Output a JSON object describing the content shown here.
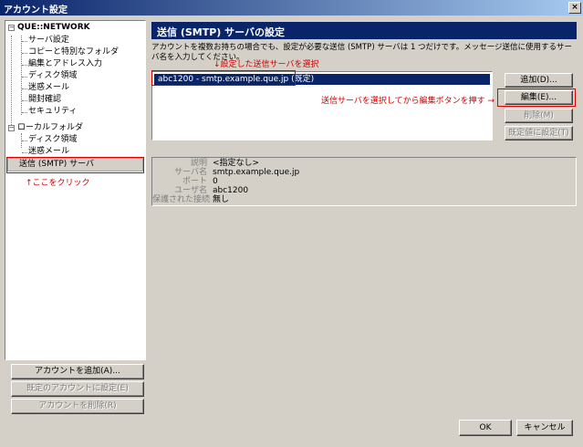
{
  "window": {
    "title": "アカウント設定",
    "close": "×"
  },
  "tree": {
    "account": "QUE::NETWORK",
    "account_children": [
      "サーバ設定",
      "コピーと特別なフォルダ",
      "編集とアドレス入力",
      "ディスク領域",
      "迷惑メール",
      "開封確認",
      "セキュリティ"
    ],
    "local": "ローカルフォルダ",
    "local_children": [
      "ディスク領域",
      "迷惑メール"
    ],
    "smtp": "送信 (SMTP) サーバ",
    "expand_glyph": "−"
  },
  "annotations": {
    "click_here": "↑ここをクリック",
    "select_server": "↓設定した送信サーバを選択",
    "press_edit": "送信サーバを選択してから編集ボタンを押す →"
  },
  "left_buttons": {
    "add_account": "アカウントを追加(A)...",
    "set_default": "既定のアカウントに設定(E)",
    "remove_account": "アカウントを削除(R)"
  },
  "panel": {
    "title": "送信 (SMTP) サーバの設定",
    "description": "アカウントを複数お持ちの場合でも、設定が必要な送信 (SMTP) サーバは 1 つだけです。メッセージ送信に使用するサーバ名を入力してください。"
  },
  "server_list": {
    "items": [
      "abc1200 - smtp.example.que.jp (既定)"
    ]
  },
  "server_buttons": {
    "add": "追加(D)...",
    "edit": "編集(E)...",
    "delete": "削除(M)",
    "set_default": "既定値に設定(T)"
  },
  "details": [
    {
      "label": "説明",
      "value": "<指定なし>"
    },
    {
      "label": "サーバ名",
      "value": "smtp.example.que.jp"
    },
    {
      "label": "ポート",
      "value": "0"
    },
    {
      "label": "ユーザ名",
      "value": "abc1200"
    },
    {
      "label": "保護された接続",
      "value": "無し"
    }
  ],
  "footer": {
    "ok": "OK",
    "cancel": "キャンセル"
  }
}
